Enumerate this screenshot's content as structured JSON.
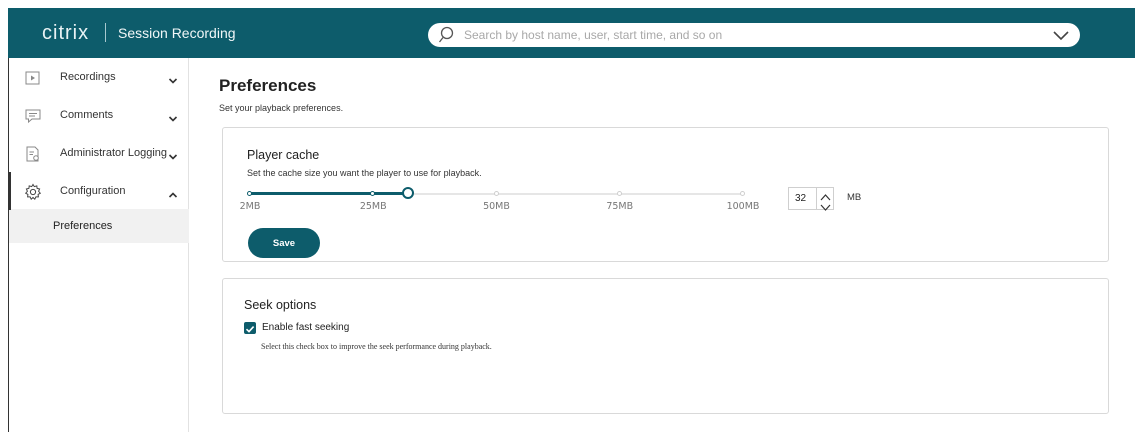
{
  "topbar": {
    "brand": "citrix",
    "product": "Session Recording",
    "search_placeholder": "Search by host name, user, start time, and so on"
  },
  "sidebar": {
    "items": [
      {
        "label": "Recordings",
        "icon": "play-icon",
        "expanded": false
      },
      {
        "label": "Comments",
        "icon": "comment-icon",
        "expanded": false
      },
      {
        "label": "Administrator Logging",
        "icon": "audit-log-icon",
        "expanded": false
      },
      {
        "label": "Configuration",
        "icon": "gear-icon",
        "expanded": true
      }
    ],
    "sub_items": [
      {
        "label": "Preferences",
        "selected": true
      }
    ]
  },
  "page": {
    "title": "Preferences",
    "subtitle": "Set your playback preferences."
  },
  "player_cache": {
    "title": "Player cache",
    "description": "Set the cache size you want the player to use for playback.",
    "slider": {
      "min": 2,
      "max": 100,
      "value": 32,
      "stops": [
        2,
        25,
        50,
        75,
        100
      ],
      "stop_labels": [
        "2MB",
        "25MB",
        "50MB",
        "75MB",
        "100MB"
      ]
    },
    "stepper_value": "32",
    "unit": "MB",
    "save_label": "Save"
  },
  "seek_options": {
    "title": "Seek options",
    "checkbox_label": "Enable fast seeking",
    "checked": true,
    "help": "Select this check box to improve the seek performance during playback."
  },
  "colors": {
    "brand_teal": "#0d5c6b",
    "card_border": "#d9d9d9"
  }
}
